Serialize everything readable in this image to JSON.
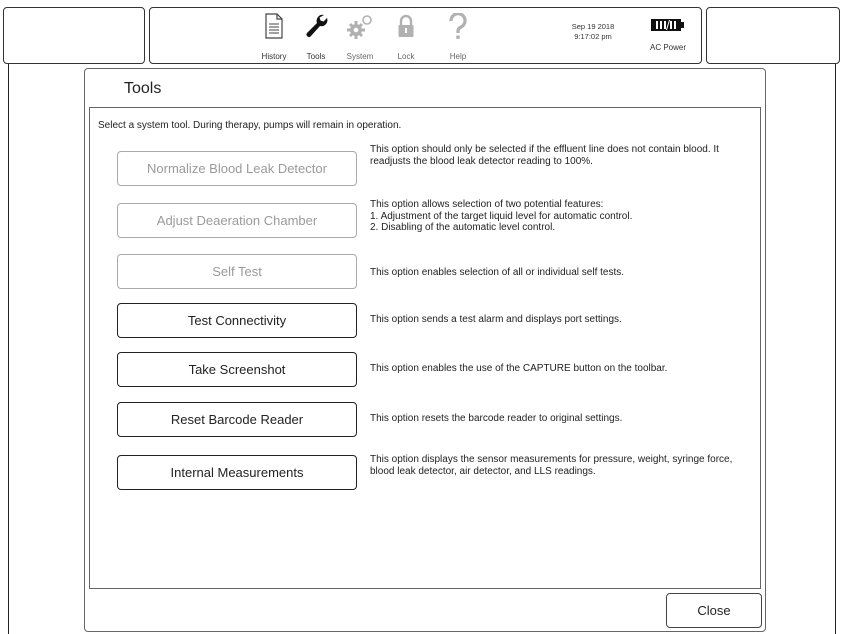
{
  "toolbar": {
    "buttons": [
      {
        "label": "History",
        "icon": "history-icon",
        "enabled": true
      },
      {
        "label": "Tools",
        "icon": "wrench-icon",
        "enabled": true
      },
      {
        "label": "System",
        "icon": "gears-icon",
        "enabled": false
      },
      {
        "label": "Lock",
        "icon": "lock-icon",
        "enabled": false
      },
      {
        "label": "Help",
        "icon": "help-icon",
        "enabled": false
      }
    ],
    "date": "Sep 19 2018",
    "time": "9:17:02 pm",
    "power_label": "AC Power",
    "power_icon": "battery-plug-icon"
  },
  "panel": {
    "title": "Tools",
    "instructions": "Select a system tool. During therapy, pumps will remain in operation.",
    "tools": [
      {
        "label": "Normalize Blood Leak Detector",
        "enabled": false,
        "description": "This option should only be selected if the effluent line does not contain blood. It readjusts the blood leak detector reading to 100%."
      },
      {
        "label": "Adjust Deaeration Chamber",
        "enabled": false,
        "description": "This option allows selection of two potential features:\n1. Adjustment of the target liquid level for automatic control.\n2. Disabling of the automatic level control."
      },
      {
        "label": "Self Test",
        "enabled": false,
        "description": "This option enables selection of all or individual self tests."
      },
      {
        "label": "Test Connectivity",
        "enabled": true,
        "description": "This option sends a test alarm and displays port settings."
      },
      {
        "label": "Take Screenshot",
        "enabled": true,
        "description": "This option enables the use of the CAPTURE button on the toolbar."
      },
      {
        "label": "Reset Barcode Reader",
        "enabled": true,
        "description": "This option resets the barcode reader to original settings."
      },
      {
        "label": "Internal Measurements",
        "enabled": true,
        "description": "This option displays the sensor measurements for pressure, weight, syringe force, blood leak detector, air detector, and LLS readings."
      }
    ],
    "close_label": "Close"
  }
}
